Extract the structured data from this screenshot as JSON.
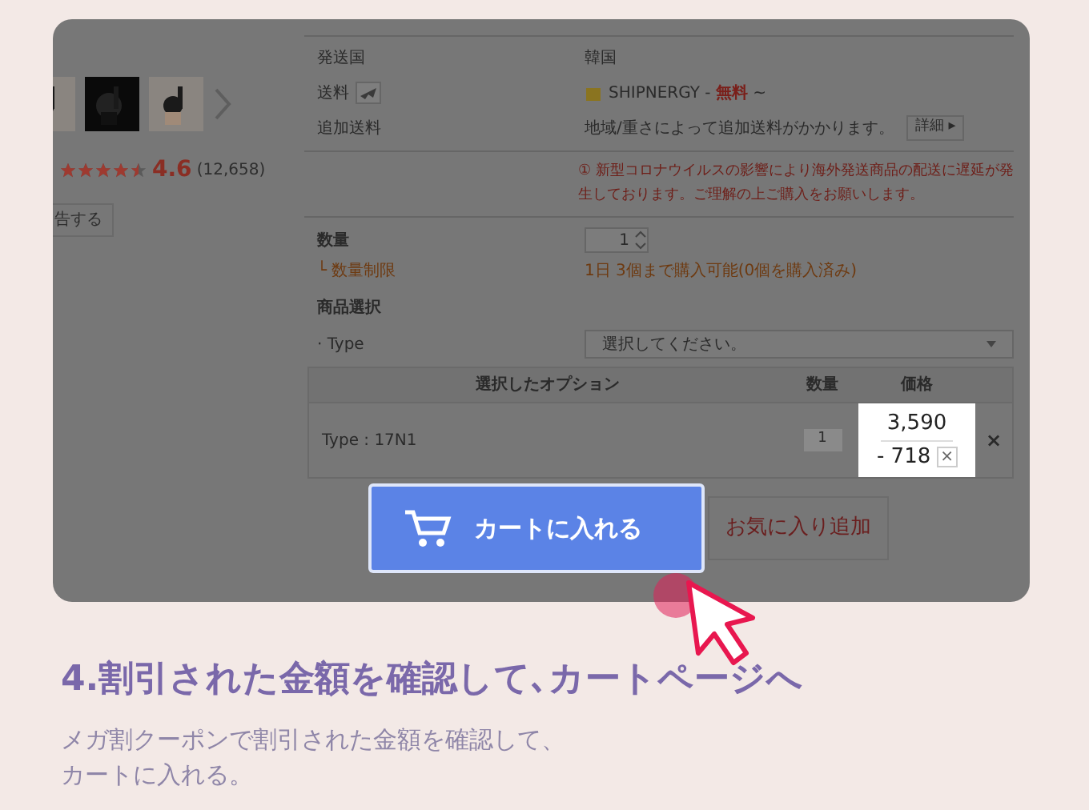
{
  "product": {
    "rating": "4.6",
    "review_count": "(12,658)",
    "stars": 4.5,
    "report_button": "告する"
  },
  "shipping": [
    {
      "label": "発送国",
      "value": "韓国",
      "kind": "text"
    },
    {
      "label": "送料",
      "value": "SHIPNERGY - ",
      "free": "無料",
      "suffix": " ~",
      "kind": "carrier"
    },
    {
      "label": "追加送料",
      "value": "地域/重さによって追加送料がかかります。",
      "button": "詳細 ▸",
      "kind": "detail"
    }
  ],
  "notice": "① 新型コロナウイルスの影響により海外発送商品の配送に遅延が発生しております。ご理解の上ご購入をお願いします。",
  "quantity": {
    "label": "数量",
    "value": "1",
    "limit_label": "└ 数量制限",
    "limit_text": "1日 3個まで購入可能(0個を購入済み)"
  },
  "option_select": {
    "title": "商品選択",
    "label": "· Type",
    "placeholder": "選択してください。"
  },
  "option_table": {
    "columns": [
      "選択したオプション",
      "数量",
      "価格"
    ],
    "rows": [
      {
        "option": "Type : 17N1",
        "quantity": "1",
        "price": "3,590",
        "discount": "- 718",
        "remove": "×"
      }
    ]
  },
  "buttons": {
    "cart": "カートに入れる",
    "favorite": "お気に入り追加"
  },
  "heading": "4.割引された金額を確認して､カートページへ",
  "description": [
    "メガ割クーポンで割引された金額を確認して、",
    "カートに入れる。"
  ]
}
